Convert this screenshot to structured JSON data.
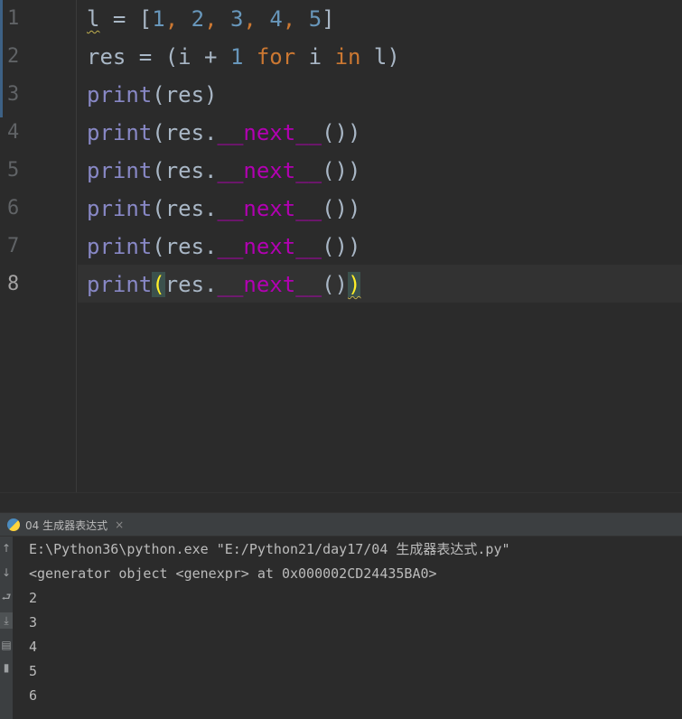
{
  "editor": {
    "line_numbers": [
      "1",
      "2",
      "3",
      "4",
      "5",
      "6",
      "7",
      "8"
    ],
    "current_line": "8",
    "lines": [
      [
        {
          "t": "l",
          "c": "sq"
        },
        {
          "t": " = [",
          "c": ""
        },
        {
          "t": "1",
          "c": "num"
        },
        {
          "t": ", ",
          "c": "kw"
        },
        {
          "t": "2",
          "c": "num"
        },
        {
          "t": ", ",
          "c": "kw"
        },
        {
          "t": "3",
          "c": "num"
        },
        {
          "t": ", ",
          "c": "kw"
        },
        {
          "t": "4",
          "c": "num"
        },
        {
          "t": ", ",
          "c": "kw"
        },
        {
          "t": "5",
          "c": "num"
        },
        {
          "t": "]",
          "c": ""
        }
      ],
      [
        {
          "t": "res = (i + ",
          "c": ""
        },
        {
          "t": "1",
          "c": "num"
        },
        {
          "t": " ",
          "c": ""
        },
        {
          "t": "for",
          "c": "kw"
        },
        {
          "t": " i ",
          "c": ""
        },
        {
          "t": "in",
          "c": "kw"
        },
        {
          "t": " l)",
          "c": ""
        }
      ],
      [
        {
          "t": "print",
          "c": "fn"
        },
        {
          "t": "(res)",
          "c": ""
        }
      ],
      [
        {
          "t": "print",
          "c": "fn"
        },
        {
          "t": "(res.",
          "c": ""
        },
        {
          "t": "__next__",
          "c": "dunder"
        },
        {
          "t": "())",
          "c": ""
        }
      ],
      [
        {
          "t": "print",
          "c": "fn"
        },
        {
          "t": "(res.",
          "c": ""
        },
        {
          "t": "__next__",
          "c": "dunder"
        },
        {
          "t": "())",
          "c": ""
        }
      ],
      [
        {
          "t": "print",
          "c": "fn"
        },
        {
          "t": "(res.",
          "c": ""
        },
        {
          "t": "__next__",
          "c": "dunder"
        },
        {
          "t": "())",
          "c": ""
        }
      ],
      [
        {
          "t": "print",
          "c": "fn"
        },
        {
          "t": "(res.",
          "c": ""
        },
        {
          "t": "__next__",
          "c": "dunder"
        },
        {
          "t": "())",
          "c": ""
        }
      ],
      [
        {
          "t": "print",
          "c": "fn"
        },
        {
          "t": "(",
          "c": "bm"
        },
        {
          "t": "res.",
          "c": ""
        },
        {
          "t": "__next__",
          "c": "dunder"
        },
        {
          "t": "()",
          "c": ""
        },
        {
          "t": ")",
          "c": "bm sq"
        }
      ]
    ]
  },
  "run_panel": {
    "tab_label": "04 生成器表达式",
    "tab_icon": "python-icon",
    "close_glyph": "×"
  },
  "console": {
    "lines": [
      "E:\\Python36\\python.exe \"E:/Python21/day17/04 生成器表达式.py\"",
      "<generator object <genexpr> at 0x000002CD24435BA0>",
      "2",
      "3",
      "4",
      "5",
      "6"
    ],
    "rail_icons": [
      "arrow-up-icon",
      "arrow-down-icon",
      "soft-wrap-icon",
      "scroll-to-end-icon",
      "print-icon",
      "trash-icon"
    ]
  },
  "colors": {
    "background": "#2b2b2b",
    "keyword": "#cc7832",
    "number": "#6897bb",
    "builtin": "#8888c6",
    "dunder": "#b200b2",
    "text": "#a9b7c6"
  }
}
